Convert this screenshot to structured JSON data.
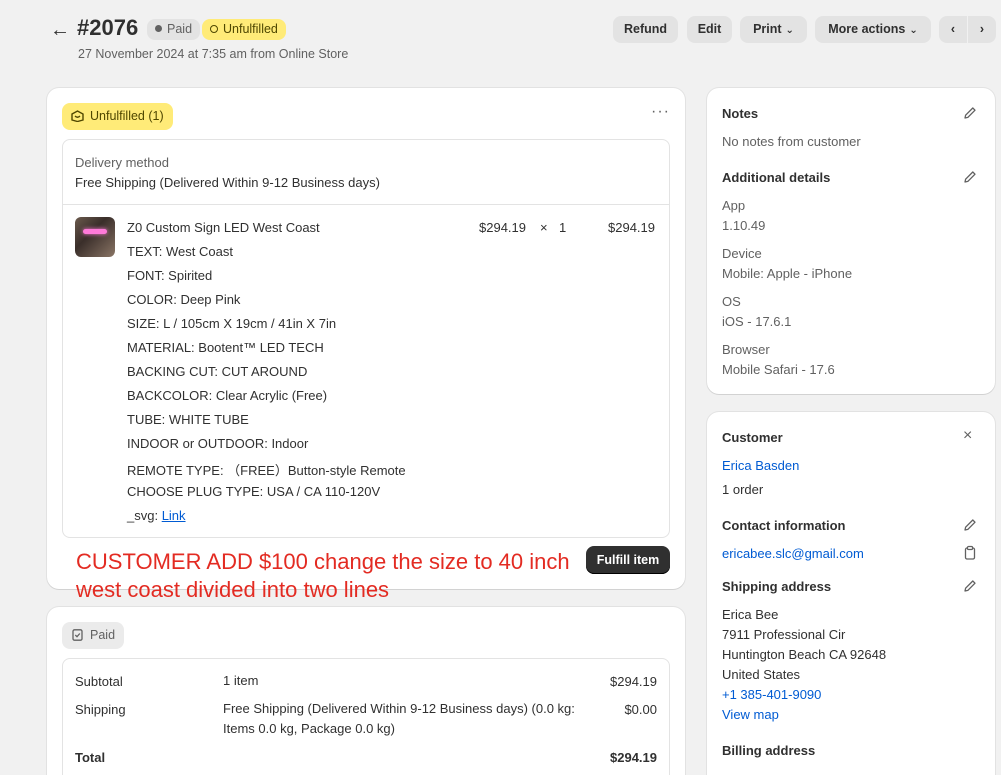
{
  "header": {
    "order_number": "#2076",
    "paid_badge": "Paid",
    "unfulfilled_badge": "Unfulfilled",
    "subtitle": "27 November 2024 at 7:35 am from Online Store",
    "buttons": {
      "refund": "Refund",
      "edit": "Edit",
      "print": "Print",
      "more_actions": "More actions"
    }
  },
  "fulfillment": {
    "status_pill": "Unfulfilled (1)",
    "delivery_label": "Delivery method",
    "delivery_value": "Free Shipping (Delivered Within 9-12 Business days)",
    "item": {
      "title": "Z0 Custom Sign LED West Coast",
      "price": "$294.19",
      "times": "×",
      "qty": "1",
      "total": "$294.19",
      "properties": [
        "TEXT: West Coast",
        "FONT: Spirited",
        "COLOR: Deep Pink",
        "SIZE: L / 105cm X 19cm / 41in X 7in",
        "MATERIAL: Bootent™ LED TECH",
        "BACKING CUT: CUT AROUND",
        "BACKCOLOR: Clear Acrylic (Free)",
        "TUBE: WHITE TUBE",
        "INDOOR or OUTDOOR: Indoor",
        "REMOTE TYPE: （FREE）Button-style Remote",
        "CHOOSE PLUG TYPE: USA / CA 110-120V"
      ],
      "svg_label": "_svg: ",
      "svg_link": "Link"
    },
    "annotation_line1": "CUSTOMER ADD $100 change the size to 40 inch",
    "annotation_line2": "west coast divided into two lines",
    "fulfill_button": "Fulfill item"
  },
  "payment": {
    "status_pill": "Paid",
    "rows": [
      {
        "label": "Subtotal",
        "desc": "1 item",
        "amount": "$294.19"
      },
      {
        "label": "Shipping",
        "desc": "Free Shipping (Delivered Within 9-12 Business days) (0.0 kg:",
        "desc2": "Items 0.0 kg, Package 0.0 kg)",
        "amount": "$0.00"
      },
      {
        "label": "Total",
        "desc": "",
        "amount": "$294.19"
      }
    ]
  },
  "notes": {
    "title": "Notes",
    "text": "No notes from customer",
    "additional_title": "Additional details",
    "details": [
      {
        "label": "App",
        "value": "1.10.49"
      },
      {
        "label": "Device",
        "value": "Mobile: Apple - iPhone"
      },
      {
        "label": "OS",
        "value": "iOS - 17.6.1"
      },
      {
        "label": "Browser",
        "value": "Mobile Safari - 17.6"
      }
    ]
  },
  "customer": {
    "title": "Customer",
    "name": "Erica Basden",
    "orders": "1 order",
    "contact_title": "Contact information",
    "email": "ericabee.slc@gmail.com",
    "shipping_title": "Shipping address",
    "address": [
      "Erica Bee",
      "7911 Professional Cir",
      "Huntington Beach CA 92648",
      "United States"
    ],
    "phone": "+1 385-401-9090",
    "view_map": "View map",
    "billing_title": "Billing address"
  }
}
